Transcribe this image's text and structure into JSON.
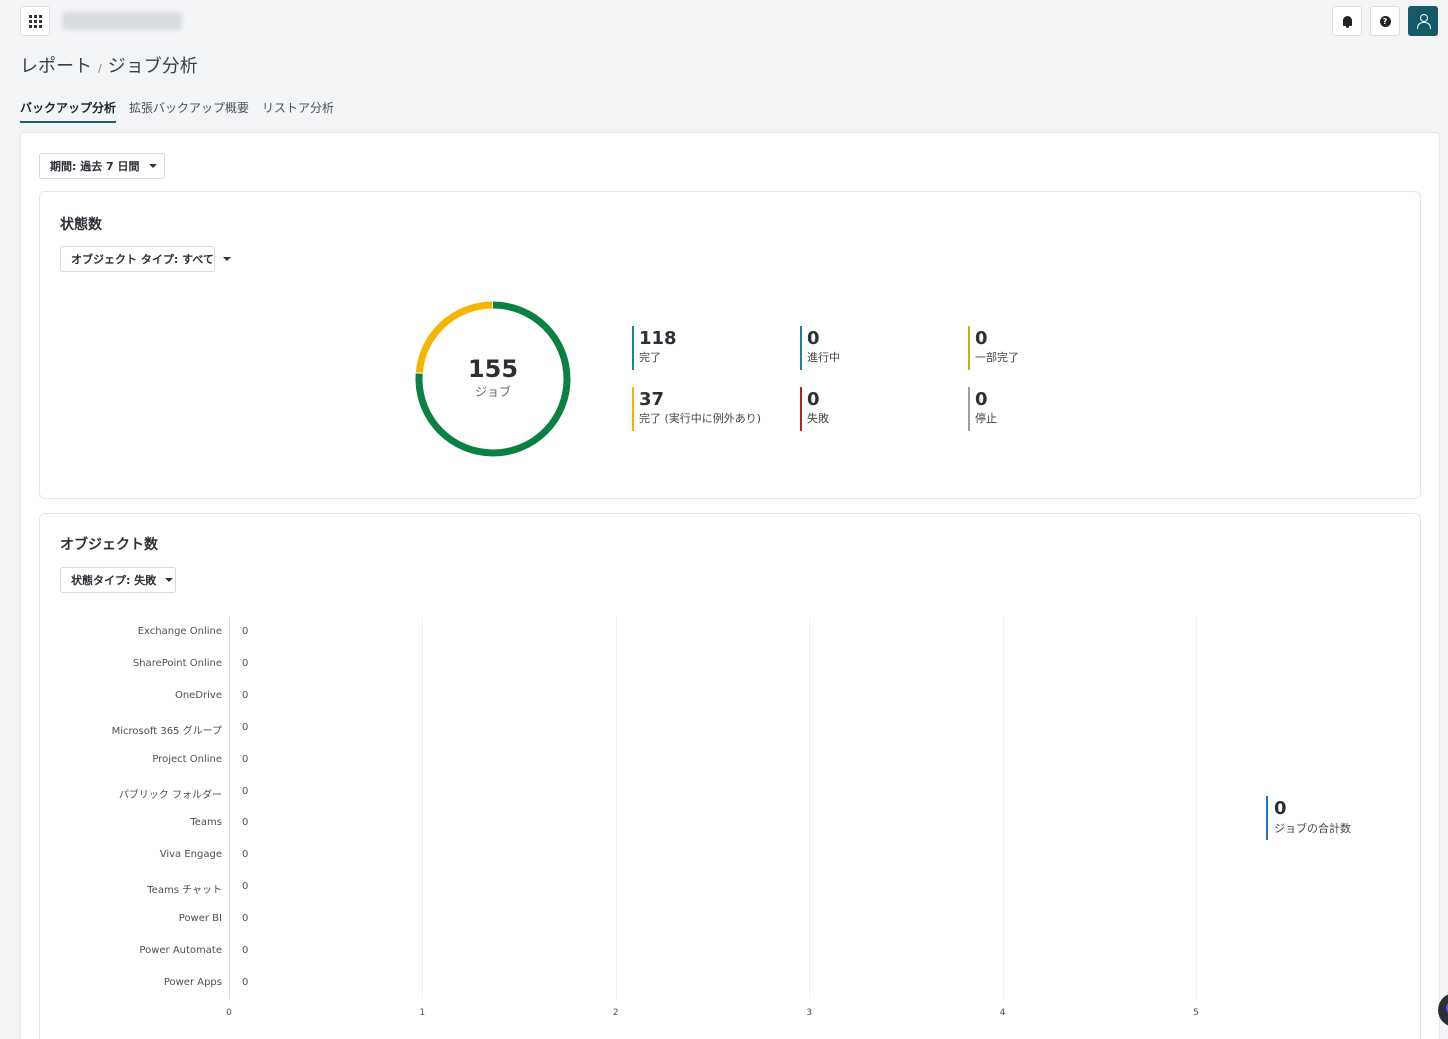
{
  "header": {
    "apps_icon": "apps-grid-icon",
    "user_icon": "user-icon",
    "bell_icon": "bell-icon",
    "help_icon": "help-icon",
    "help_glyph": "?",
    "brand_color": "#145a6b"
  },
  "breadcrumb": {
    "parent": "レポート",
    "separator": "/",
    "current": "ジョブ分析"
  },
  "tabs": [
    {
      "label": "バックアップ分析",
      "active": true
    },
    {
      "label": "拡張バックアップ概要",
      "active": false
    },
    {
      "label": "リストア分析",
      "active": false
    }
  ],
  "filters": {
    "period": "期間: 過去 7 日間"
  },
  "status_card": {
    "title": "状態数",
    "object_type_filter": "オブジェクト タイプ: すべて",
    "total": "155",
    "total_label": "ジョブ",
    "stats": [
      {
        "value": "118",
        "label": "完了",
        "color": "#1b7fa3"
      },
      {
        "value": "0",
        "label": "進行中",
        "color": "#1b7fa3"
      },
      {
        "value": "0",
        "label": "一部完了",
        "color": "#c7b400"
      },
      {
        "value": "37",
        "label": "完了 (実行中に例外あり)",
        "color": "#f4b400"
      },
      {
        "value": "0",
        "label": "失敗",
        "color": "#b3261e"
      },
      {
        "value": "0",
        "label": "停止",
        "color": "#9aa0a6"
      }
    ],
    "donut_colors": {
      "completed": "#0a8043",
      "exceptions": "#f4b400"
    }
  },
  "object_card": {
    "title": "オブジェクト数",
    "state_filter": "状態タイプ: 失敗",
    "total_value": "0",
    "total_label": "ジョブの合計数"
  },
  "chart_data": {
    "type": "bar",
    "orientation": "horizontal",
    "categories": [
      "Exchange Online",
      "SharePoint Online",
      "OneDrive",
      "Microsoft 365 グループ",
      "Project Online",
      "パブリック フォルダー",
      "Teams",
      "Viva Engage",
      "Teams チャット",
      "Power BI",
      "Power Automate",
      "Power Apps"
    ],
    "values": [
      0,
      0,
      0,
      0,
      0,
      0,
      0,
      0,
      0,
      0,
      0,
      0
    ],
    "value_labels": [
      "0",
      "0",
      "0",
      "0",
      "0",
      "0",
      "0",
      "0",
      "0",
      "0",
      "0",
      "0"
    ],
    "xticks": [
      "0",
      "1",
      "2",
      "3",
      "4",
      "5"
    ],
    "xlim": [
      0,
      5
    ],
    "grid": true
  }
}
